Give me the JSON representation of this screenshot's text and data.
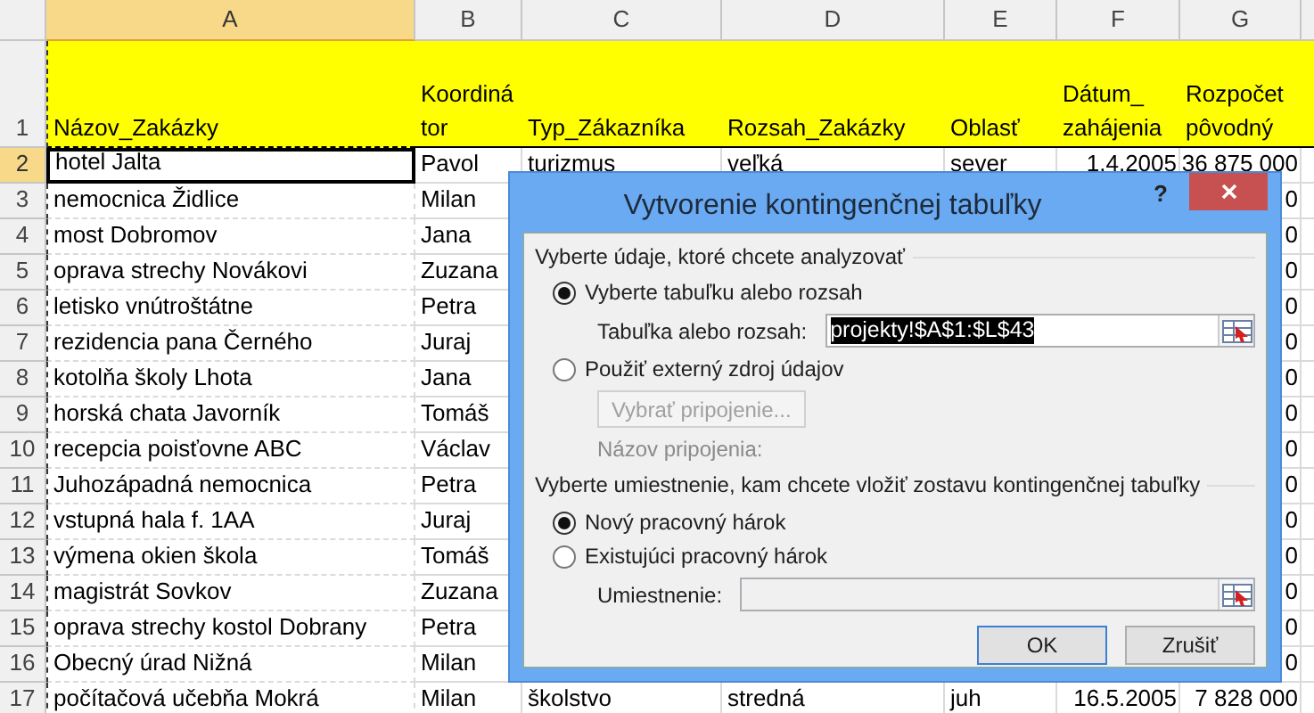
{
  "columns": [
    {
      "label": "A",
      "selected": true,
      "kind": "text"
    },
    {
      "label": "B",
      "selected": false,
      "kind": "text"
    },
    {
      "label": "C",
      "selected": false,
      "kind": "text"
    },
    {
      "label": "D",
      "selected": false,
      "kind": "text"
    },
    {
      "label": "E",
      "selected": false,
      "kind": "text"
    },
    {
      "label": "F",
      "selected": false,
      "kind": "number"
    },
    {
      "label": "G",
      "selected": false,
      "kind": "number"
    }
  ],
  "rows": [
    {
      "number": "1",
      "kind": "header",
      "selected": false,
      "cells": {
        "A": "Názov_Zakázky",
        "B": "Koordiná\ntor",
        "C": "Typ_Zákazníka",
        "D": "Rozsah_Zakázky",
        "E": "Oblasť",
        "F": "Dátum_\nzahájenia",
        "G": "Rozpočet\npôvodný"
      }
    },
    {
      "number": "2",
      "kind": "data",
      "selected": true,
      "cells": {
        "A": "hotel Jalta",
        "B": "Pavol",
        "C": "turizmus",
        "D": "veľká",
        "E": "sever",
        "F": "1.4.2005",
        "G": "36 875 000"
      }
    },
    {
      "number": "3",
      "kind": "data",
      "selected": false,
      "cells": {
        "A": "nemocnica Židlice",
        "B": "Milan",
        "G": "0"
      }
    },
    {
      "number": "4",
      "kind": "data",
      "selected": false,
      "cells": {
        "A": "most Dobromov",
        "B": "Jana",
        "G": "0"
      }
    },
    {
      "number": "5",
      "kind": "data",
      "selected": false,
      "cells": {
        "A": "oprava strechy Novákovi",
        "B": "Zuzana",
        "G": "0"
      }
    },
    {
      "number": "6",
      "kind": "data",
      "selected": false,
      "cells": {
        "A": "letisko vnútroštátne",
        "B": "Petra",
        "G": "0"
      }
    },
    {
      "number": "7",
      "kind": "data",
      "selected": false,
      "cells": {
        "A": "rezidencia pana Černého",
        "B": "Juraj",
        "G": "0"
      }
    },
    {
      "number": "8",
      "kind": "data",
      "selected": false,
      "cells": {
        "A": "kotolňa školy Lhota",
        "B": "Jana",
        "G": "0"
      }
    },
    {
      "number": "9",
      "kind": "data",
      "selected": false,
      "cells": {
        "A": "horská chata Javorník",
        "B": "Tomáš",
        "G": "0"
      }
    },
    {
      "number": "10",
      "kind": "data",
      "selected": false,
      "cells": {
        "A": "recepcia poisťovne ABC",
        "B": "Václav",
        "G": "0"
      }
    },
    {
      "number": "11",
      "kind": "data",
      "selected": false,
      "cells": {
        "A": "Juhozápadná nemocnica",
        "B": "Petra",
        "G": "0"
      }
    },
    {
      "number": "12",
      "kind": "data",
      "selected": false,
      "cells": {
        "A": "vstupná hala f. 1AA",
        "B": "Juraj",
        "G": "0"
      }
    },
    {
      "number": "13",
      "kind": "data",
      "selected": false,
      "cells": {
        "A": "výmena okien škola",
        "B": "Tomáš",
        "G": "0"
      }
    },
    {
      "number": "14",
      "kind": "data",
      "selected": false,
      "cells": {
        "A": "magistrát Sovkov",
        "B": "Zuzana",
        "G": "0"
      }
    },
    {
      "number": "15",
      "kind": "data",
      "selected": false,
      "cells": {
        "A": "oprava strechy kostol Dobrany",
        "B": "Petra",
        "G": "0"
      }
    },
    {
      "number": "16",
      "kind": "data",
      "selected": false,
      "cells": {
        "A": "Obecný úrad Nižná",
        "B": "Milan",
        "G": "0"
      }
    },
    {
      "number": "17",
      "kind": "data",
      "selected": false,
      "cells": {
        "A": "počítačová učebňa Mokrá",
        "B": "Milan",
        "C": "školstvo",
        "D": "stredná",
        "E": "juh",
        "F": "16.5.2005",
        "G": "7 828 000"
      }
    }
  ],
  "dialog": {
    "title": "Vytvorenie kontingenčnej tabuľky",
    "help": "?",
    "source_heading": "Vyberte údaje, ktoré chcete analyzovať",
    "source_options": [
      {
        "label": "Vyberte tabuľku alebo rozsah",
        "selected": true
      },
      {
        "label": "Použiť externý zdroj údajov",
        "selected": false
      }
    ],
    "range_field": {
      "label": "Tabuľka alebo rozsah:",
      "value": "projekty!$A$1:$L$43",
      "highlighted": true
    },
    "connection_button": {
      "label": "Vybrať pripojenie...",
      "disabled": true
    },
    "connection_name": {
      "label": "Názov pripojenia:",
      "disabled": true
    },
    "location_heading": "Vyberte umiestnenie, kam chcete vložiť zostavu kontingenčnej tabuľky",
    "location_options": [
      {
        "label": "Nový pracovný hárok",
        "selected": true
      },
      {
        "label": "Existujúci pracovný hárok",
        "selected": false
      }
    ],
    "location_field": {
      "label": "Umiestnenie:",
      "disabled": true
    },
    "buttons": [
      {
        "label": "OK",
        "default": true
      },
      {
        "label": "Zrušiť",
        "default": false
      }
    ]
  }
}
